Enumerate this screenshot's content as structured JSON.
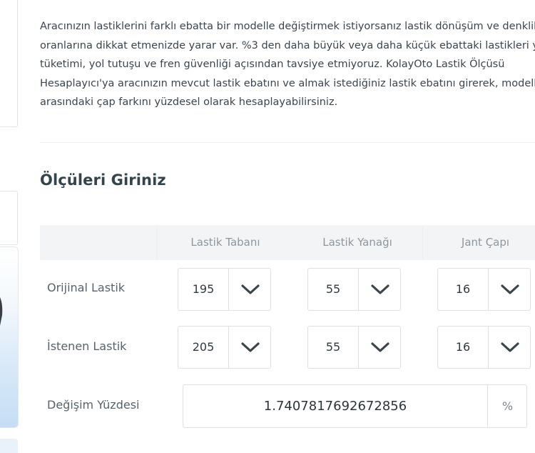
{
  "intro": {
    "lines": [
      "Aracınızın lastiklerini farklı ebatta bir modelle değiştirmek istiyorsanız lastik dönüşüm ve denklik",
      "oranlarına dikkat etmenizde yarar var. %3 den daha büyük veya daha küçük ebattaki lastikleri yakıt",
      "tüketimi, yol tutuşu ve fren güvenliği açısından tavsiye etmiyoruz. KolayOto Lastik Ölçüsü",
      "Hesaplayıcı'ya aracınızın mevcut lastik ebatını ve almak istediğiniz lastik ebatını girerek, modeller",
      "arasındaki çap farkını yüzdesel olarak hesaplayabilirsiniz."
    ]
  },
  "section_title": "Ölçüleri Giriniz",
  "table": {
    "headers": [
      "",
      "Lastik Tabanı",
      "Lastik Yanağı",
      "Jant Çapı"
    ],
    "rows": [
      {
        "label": "Orijinal Lastik",
        "values": [
          "195",
          "55",
          "16"
        ]
      },
      {
        "label": "İstenen Lastik",
        "values": [
          "205",
          "55",
          "16"
        ]
      }
    ],
    "result": {
      "label": "Değişim Yüzdesi",
      "value": "1.7407817692672856",
      "unit": "%"
    }
  },
  "icons": {
    "dropdown": "chevron-down-icon"
  },
  "colors": {
    "text": "#3a4550",
    "header_bg": "#f3f4f5",
    "border": "#dde1e4",
    "muted": "#8e979d"
  }
}
